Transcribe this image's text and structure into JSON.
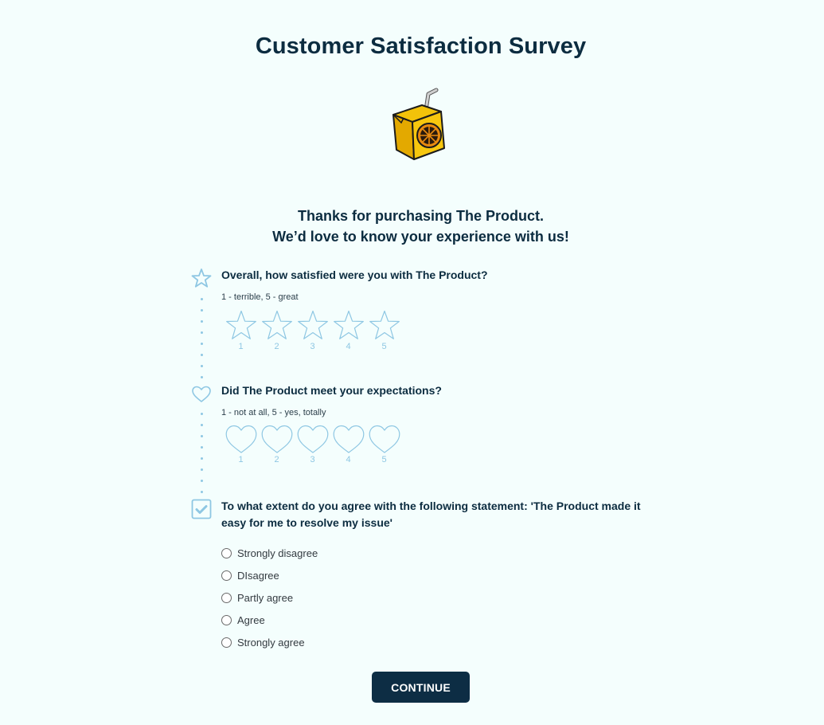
{
  "header": {
    "title": "Customer Satisfaction Survey",
    "logo": "juice-box-icon"
  },
  "intro": {
    "line1": "Thanks for purchasing The Product.",
    "line2": "We’d love to know your experience with us!"
  },
  "questions": [
    {
      "icon": "star-icon",
      "title": "Overall, how satisfied were you with The Product?",
      "hint": "1 - terrible, 5 - great",
      "type": "star-rating",
      "scale": [
        "1",
        "2",
        "3",
        "4",
        "5"
      ],
      "selected": null
    },
    {
      "icon": "heart-icon",
      "title": "Did The Product meet your expectations?",
      "hint": "1 - not at all, 5 - yes, totally",
      "type": "heart-rating",
      "scale": [
        "1",
        "2",
        "3",
        "4",
        "5"
      ],
      "selected": null
    },
    {
      "icon": "checkbox-icon",
      "title_line1": "To what extent do you agree with the following statement: 'The Product made it",
      "title_line2": "easy for me to resolve my issue'",
      "type": "single-choice",
      "options": [
        "Strongly disagree",
        "DIsagree",
        "Partly agree",
        "Agree",
        "Strongly agree"
      ],
      "selected": null
    }
  ],
  "actions": {
    "continue_label": "CONTINUE"
  },
  "colors": {
    "primary": "#0d2d44",
    "accent": "#8ec7e3",
    "background": "#f4fefd"
  }
}
